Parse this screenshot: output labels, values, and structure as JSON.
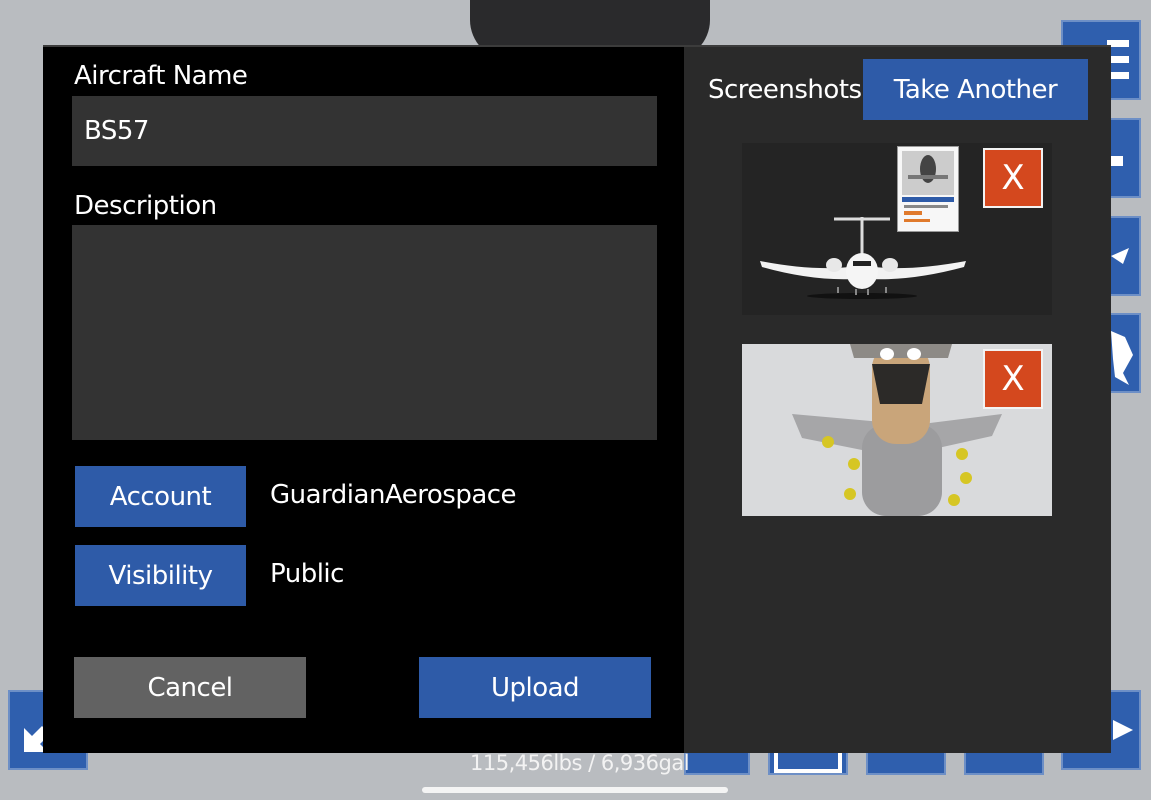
{
  "dialog": {
    "aircraft_name_label": "Aircraft Name",
    "aircraft_name_value": "BS57",
    "description_label": "Description",
    "description_value": "",
    "account_button": "Account",
    "account_value": "GuardianAerospace",
    "visibility_button": "Visibility",
    "visibility_value": "Public",
    "cancel_button": "Cancel",
    "upload_button": "Upload"
  },
  "screenshots": {
    "title": "Screenshots",
    "take_another_button": "Take Another",
    "items": [
      {
        "delete_label": "X",
        "icon": "airplane-render-thumbnail"
      },
      {
        "delete_label": "X",
        "icon": "plush-toy-photo-thumbnail"
      }
    ]
  },
  "background": {
    "stats_text": "115,456lbs / 6,936gal"
  },
  "colors": {
    "accent_blue": "#2e5ba8",
    "delete_red": "#d4481e",
    "cancel_gray": "#626262",
    "dialog_bg": "#000000",
    "panel_bg": "#2a2a2a",
    "field_bg": "#333333"
  }
}
